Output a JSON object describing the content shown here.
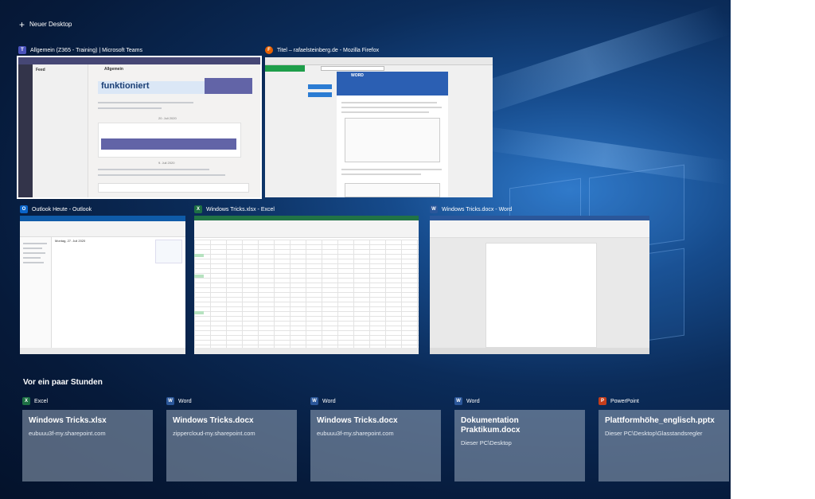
{
  "task_view": {
    "new_desktop_label": "Neuer Desktop",
    "windows": [
      {
        "title": "Allgemein (Z365 - Training) | Microsoft Teams",
        "app": "Microsoft Teams",
        "icon": "teams-icon",
        "color": "#4b53bc",
        "glyph": "T",
        "selected": true
      },
      {
        "title": "Titel – rafaelsteinberg.de - Mozilla Firefox",
        "app": "Mozilla Firefox",
        "icon": "firefox-icon",
        "color": "#e66000",
        "glyph": "F"
      },
      {
        "title": "Outlook Heute - Outlook",
        "app": "Outlook",
        "icon": "outlook-icon",
        "color": "#0a64c8",
        "glyph": "O"
      },
      {
        "title": "Windows Tricks.xlsx - Excel",
        "app": "Excel",
        "icon": "excel-icon",
        "color": "#1d7044",
        "glyph": "X"
      },
      {
        "title": "Windows Tricks.docx - Word",
        "app": "Word",
        "icon": "word-icon",
        "color": "#2b579a",
        "glyph": "W"
      }
    ],
    "timeline": {
      "section_title": "Vor ein paar Stunden",
      "cards": [
        {
          "app": "Excel",
          "name": "Windows Tricks.xlsx",
          "location": "eubuuu3f-my.sharepoint.com",
          "color": "#1d7044",
          "glyph": "X"
        },
        {
          "app": "Word",
          "name": "Windows Tricks.docx",
          "location": "zippercloud-my.sharepoint.com",
          "color": "#2b579a",
          "glyph": "W"
        },
        {
          "app": "Word",
          "name": "Windows Tricks.docx",
          "location": "eubuuu3f-my.sharepoint.com",
          "color": "#2b579a",
          "glyph": "W"
        },
        {
          "app": "Word",
          "name": "Dokumentation Praktikum.docx",
          "location": "Dieser PC\\Desktop",
          "color": "#2b579a",
          "glyph": "W"
        },
        {
          "app": "PowerPoint",
          "name": "Plattformhöhe_englisch.pptx",
          "location": "Dieser PC\\Desktop\\Glasstandsregler",
          "color": "#c43e1c",
          "glyph": "P"
        }
      ]
    }
  },
  "teams_preview": {
    "heading": "funktioniert",
    "sidebar_title": "Feed",
    "channel": "Allgemein",
    "date_1": "20. Juli 2020",
    "date_2": "9. Juli 2020"
  },
  "firefox_preview": {
    "logo_text": "WORD"
  },
  "outlook_preview": {
    "date_label": "Montag, 27. Juli 2020"
  }
}
